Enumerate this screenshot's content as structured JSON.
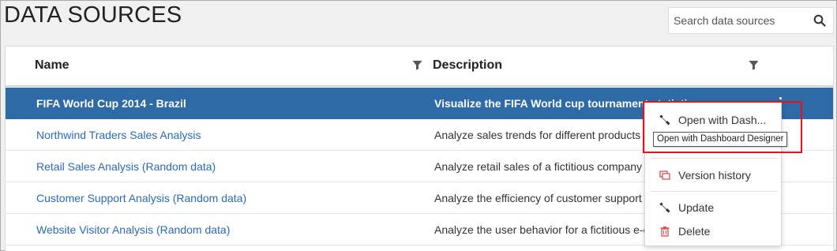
{
  "page": {
    "title": "DATA SOURCES"
  },
  "search": {
    "placeholder": "Search data sources"
  },
  "table": {
    "columns": {
      "name": "Name",
      "description": "Description"
    },
    "rows": [
      {
        "name": "FIFA World Cup 2014 - Brazil",
        "description": "Visualize the FIFA World cup tournament statistics"
      },
      {
        "name": "Northwind Traders Sales Analysis",
        "description": "Analyze sales trends for different products"
      },
      {
        "name": "Retail Sales Analysis (Random data)",
        "description": "Analyze retail sales of a fictitious company"
      },
      {
        "name": "Customer Support Analysis (Random data)",
        "description": "Analyze the efficiency of customer support"
      },
      {
        "name": "Website Visitor Analysis (Random data)",
        "description": "Analyze the user behavior for a fictitious e-commerce"
      }
    ]
  },
  "context_menu": {
    "open_with": "Open with Dash...",
    "version_history": "Version history",
    "update": "Update",
    "delete": "Delete"
  },
  "tooltip": {
    "text": "Open with Dashboard Designer"
  },
  "colors": {
    "selected_row": "#2e6aa6",
    "link": "#2d6bb3",
    "highlight": "#e0141f",
    "delete_icon": "#d9534f",
    "version_icon": "#d9534f"
  }
}
